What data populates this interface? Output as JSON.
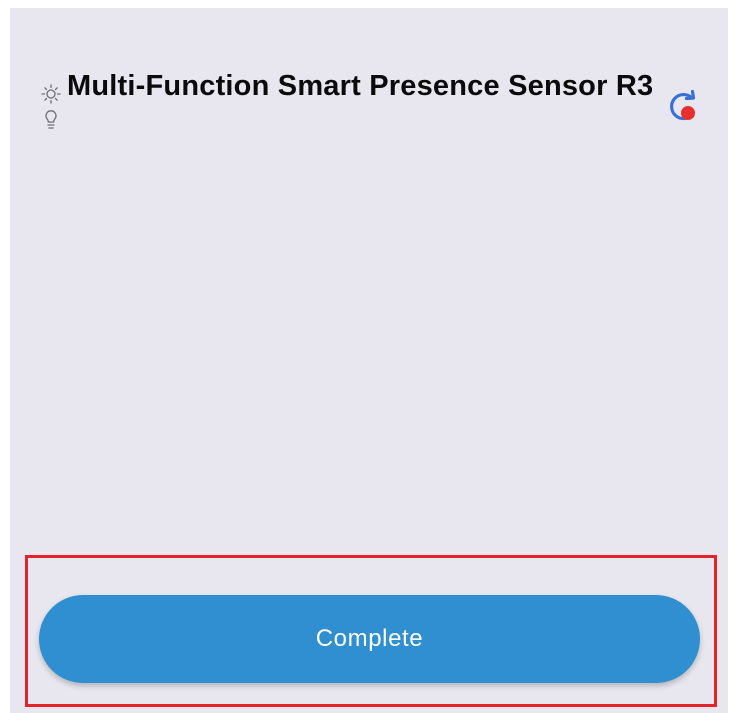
{
  "device": {
    "title": "Multi-Function Smart Presence Sensor R3",
    "icon": "sun-bulb-icon",
    "refresh_icon": "refresh-icon",
    "refresh_badge_color": "#e8302f"
  },
  "footer": {
    "complete_label": "Complete"
  },
  "colors": {
    "background": "#e8e7ef",
    "button": "#2f8fd0",
    "button_text": "#ffffff",
    "highlight": "#e3242b",
    "refresh_accent": "#3a6fd8"
  }
}
